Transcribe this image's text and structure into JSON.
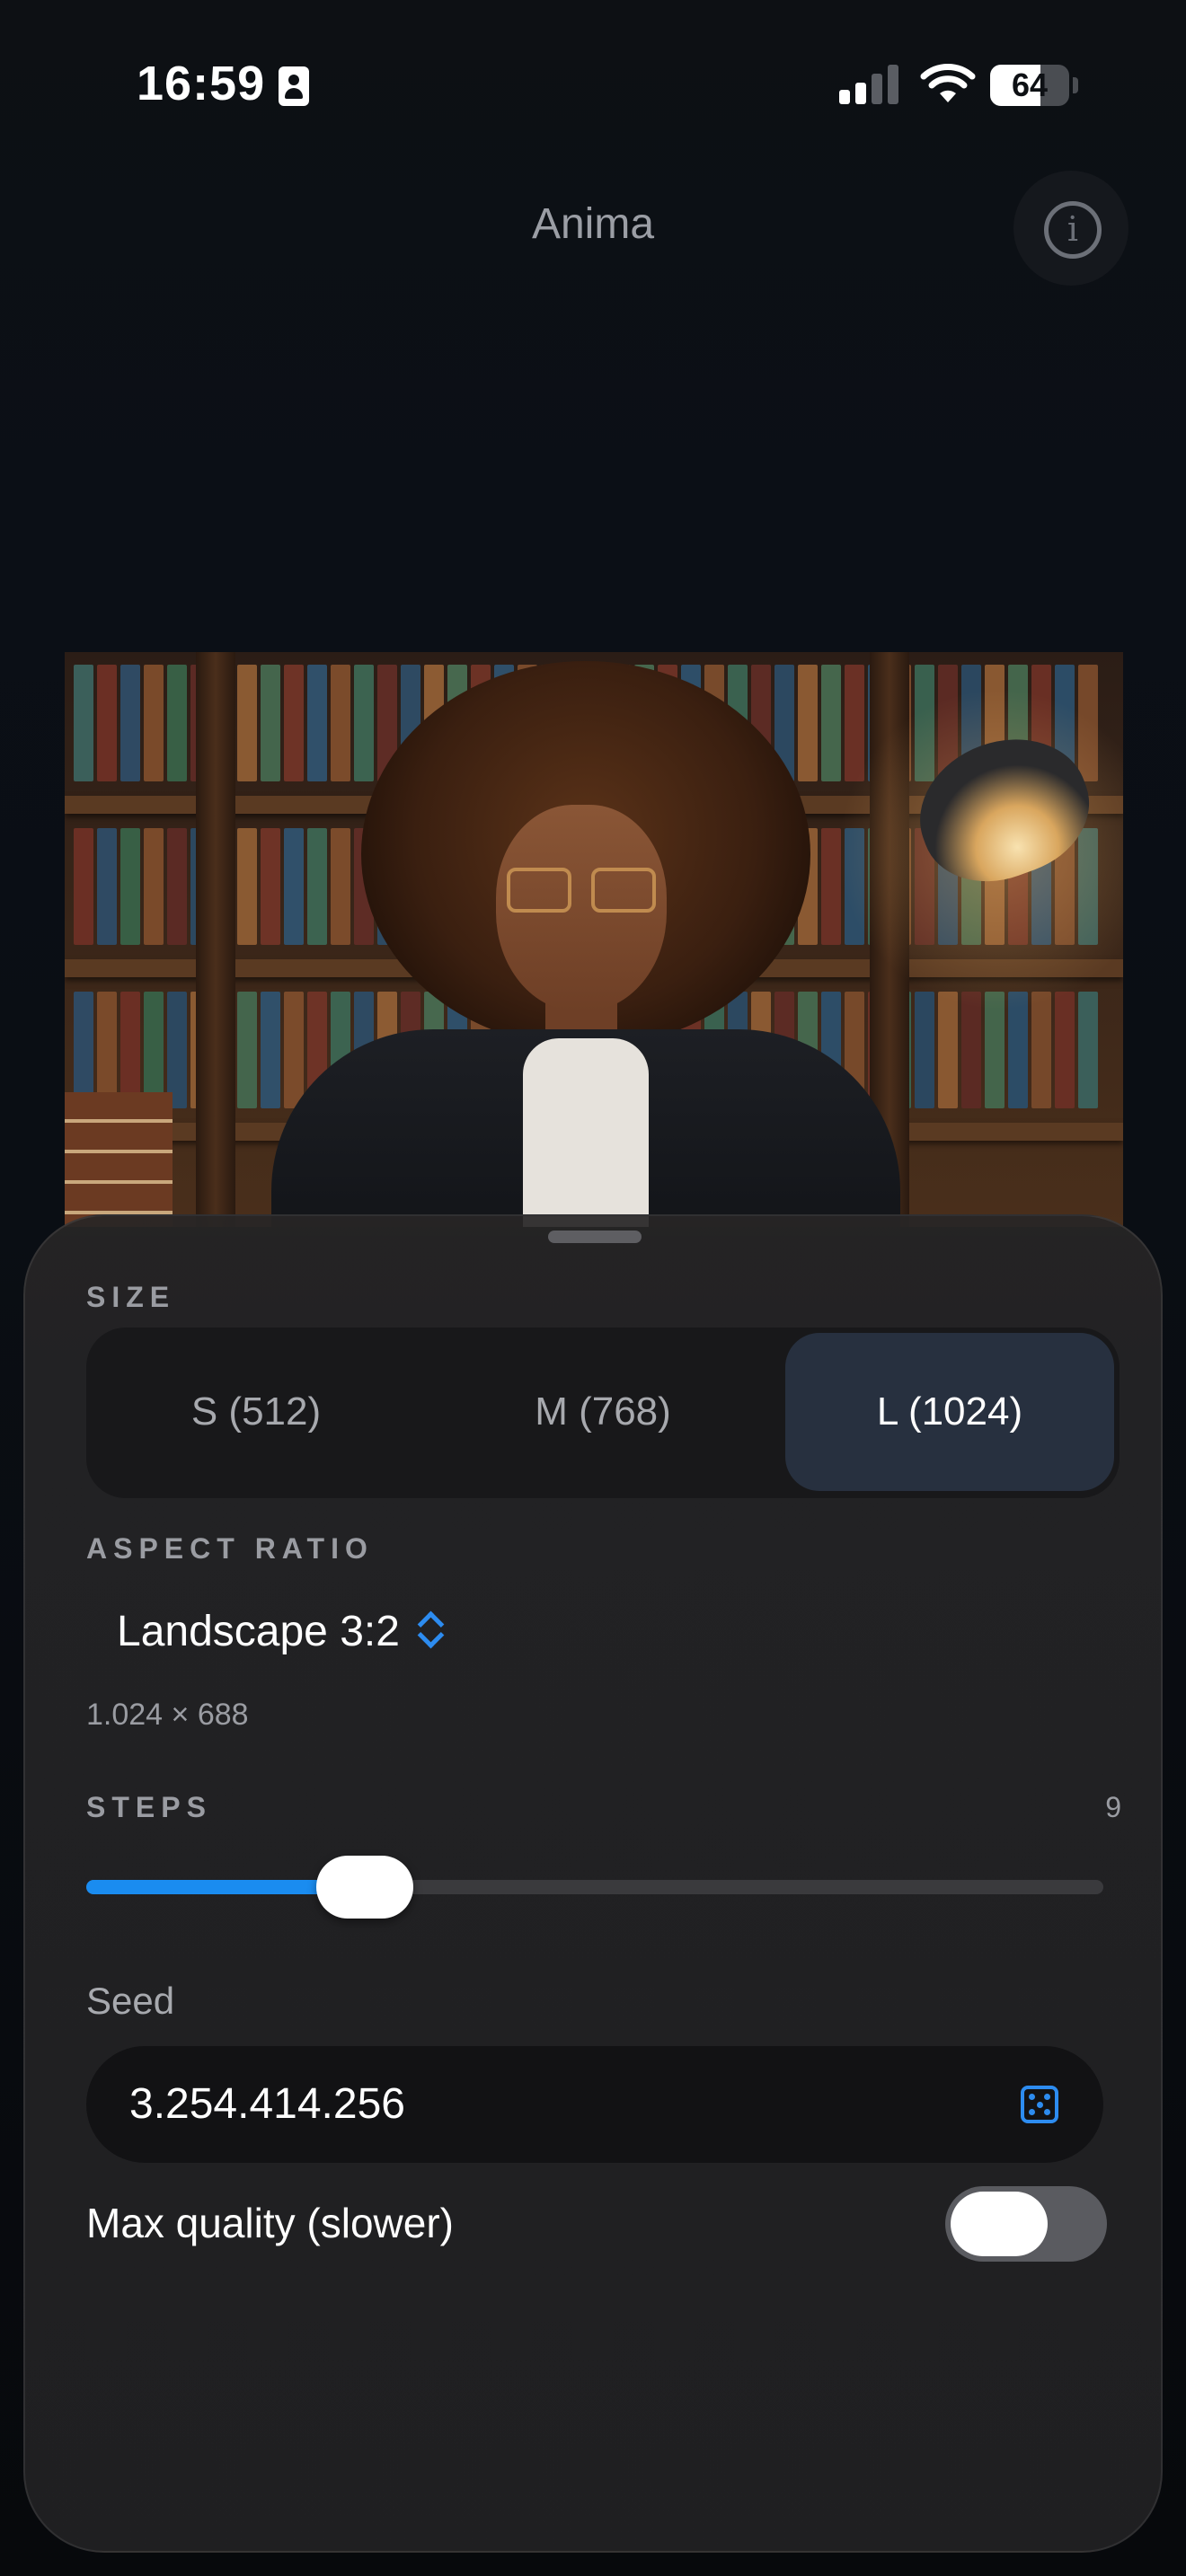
{
  "status_bar": {
    "time": "16:59",
    "battery": "64",
    "battery_level": 0.64
  },
  "header": {
    "title": "Anima"
  },
  "artwork": {},
  "settings": {
    "size_label": "SIZE",
    "sizes": [
      {
        "label": "S (512)",
        "selected": false
      },
      {
        "label": "M (768)",
        "selected": false
      },
      {
        "label": "L (1024)",
        "selected": true
      }
    ],
    "aspect_label": "ASPECT RATIO",
    "aspect_value": "Landscape 3:2",
    "dimensions": "1.024 × 688",
    "steps_label": "STEPS",
    "steps_value": "9",
    "steps_fraction": 0.25,
    "seed_label": "Seed",
    "seed_value": "3.254.414.256",
    "max_quality_label": "Max quality (slower)",
    "max_quality_on": false
  },
  "colors": {
    "accent": "#1a8cf0",
    "selected_segment": "#27303f",
    "sheet_bg": "#1f1f21"
  }
}
